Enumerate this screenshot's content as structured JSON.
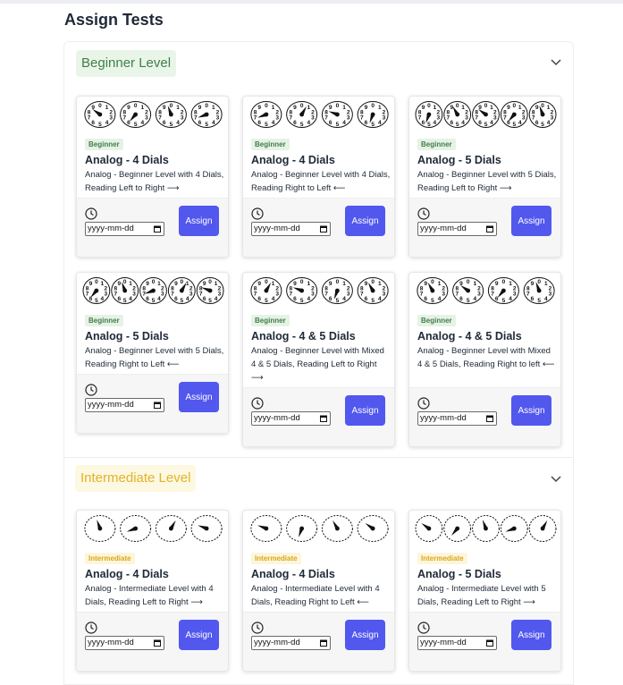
{
  "page": {
    "title": "Assign Tests"
  },
  "colors": {
    "assign_button": "#5257ee",
    "beginner_accent": "#3f7f46",
    "intermediate_accent": "#e0b428"
  },
  "sections": [
    {
      "label": "Beginner Level",
      "chevron_icon": "chevron-down-icon",
      "cards": [
        {
          "tag": "Beginner",
          "title": "Analog - 4 Dials",
          "description": "Analog - Beginner Level with 4 Dials, Reading Left to Right ⟶",
          "date_placeholder": "yyyy-mm-dd",
          "button": "Assign"
        },
        {
          "tag": "Beginner",
          "title": "Analog - 4 Dials",
          "description": "Analog - Beginner Level with 4 Dials, Reading Right to Left ⟵",
          "date_placeholder": "yyyy-mm-dd",
          "button": "Assign"
        },
        {
          "tag": "Beginner",
          "title": "Analog - 5 Dials",
          "description": "Analog - Beginner Level with 5 Dials, Reading Left to Right ⟶",
          "date_placeholder": "yyyy-mm-dd",
          "button": "Assign"
        },
        {
          "tag": "Beginner",
          "title": "Analog - 5 Dials",
          "description": "Analog - Beginner Level with 5 Dials, Reading Right to Left ⟵",
          "date_placeholder": "yyyy-mm-dd",
          "button": "Assign"
        },
        {
          "tag": "Beginner",
          "title": "Analog - 4 & 5 Dials",
          "description": "Analog - Beginner Level with Mixed 4 & 5 Dials, Reading Left to Right ⟶",
          "date_placeholder": "yyyy-mm-dd",
          "button": "Assign"
        },
        {
          "tag": "Beginner",
          "title": "Analog - 4 & 5 Dials",
          "description": "Analog - Beginner Level with Mixed 4 & 5 Dials, Reading Right to left ⟵",
          "date_placeholder": "yyyy-mm-dd",
          "button": "Assign"
        }
      ]
    },
    {
      "label": "Intermediate Level",
      "chevron_icon": "chevron-down-icon",
      "cards": [
        {
          "tag": "Intermediate",
          "title": "Analog - 4 Dials",
          "description": "Analog - Intermediate Level with 4 Dials, Reading Left to Right ⟶",
          "date_placeholder": "yyyy-mm-dd",
          "button": "Assign"
        },
        {
          "tag": "Intermediate",
          "title": "Analog - 4 Dials",
          "description": "Analog - Intermediate Level with 4 Dials, Reading Right to Left ⟵",
          "date_placeholder": "yyyy-mm-dd",
          "button": "Assign"
        },
        {
          "tag": "Intermediate",
          "title": "Analog - 5 Dials",
          "description": "Analog - Intermediate Level with 5 Dials, Reading Left to Right ⟶",
          "date_placeholder": "yyyy-mm-dd",
          "button": "Assign"
        }
      ]
    }
  ]
}
